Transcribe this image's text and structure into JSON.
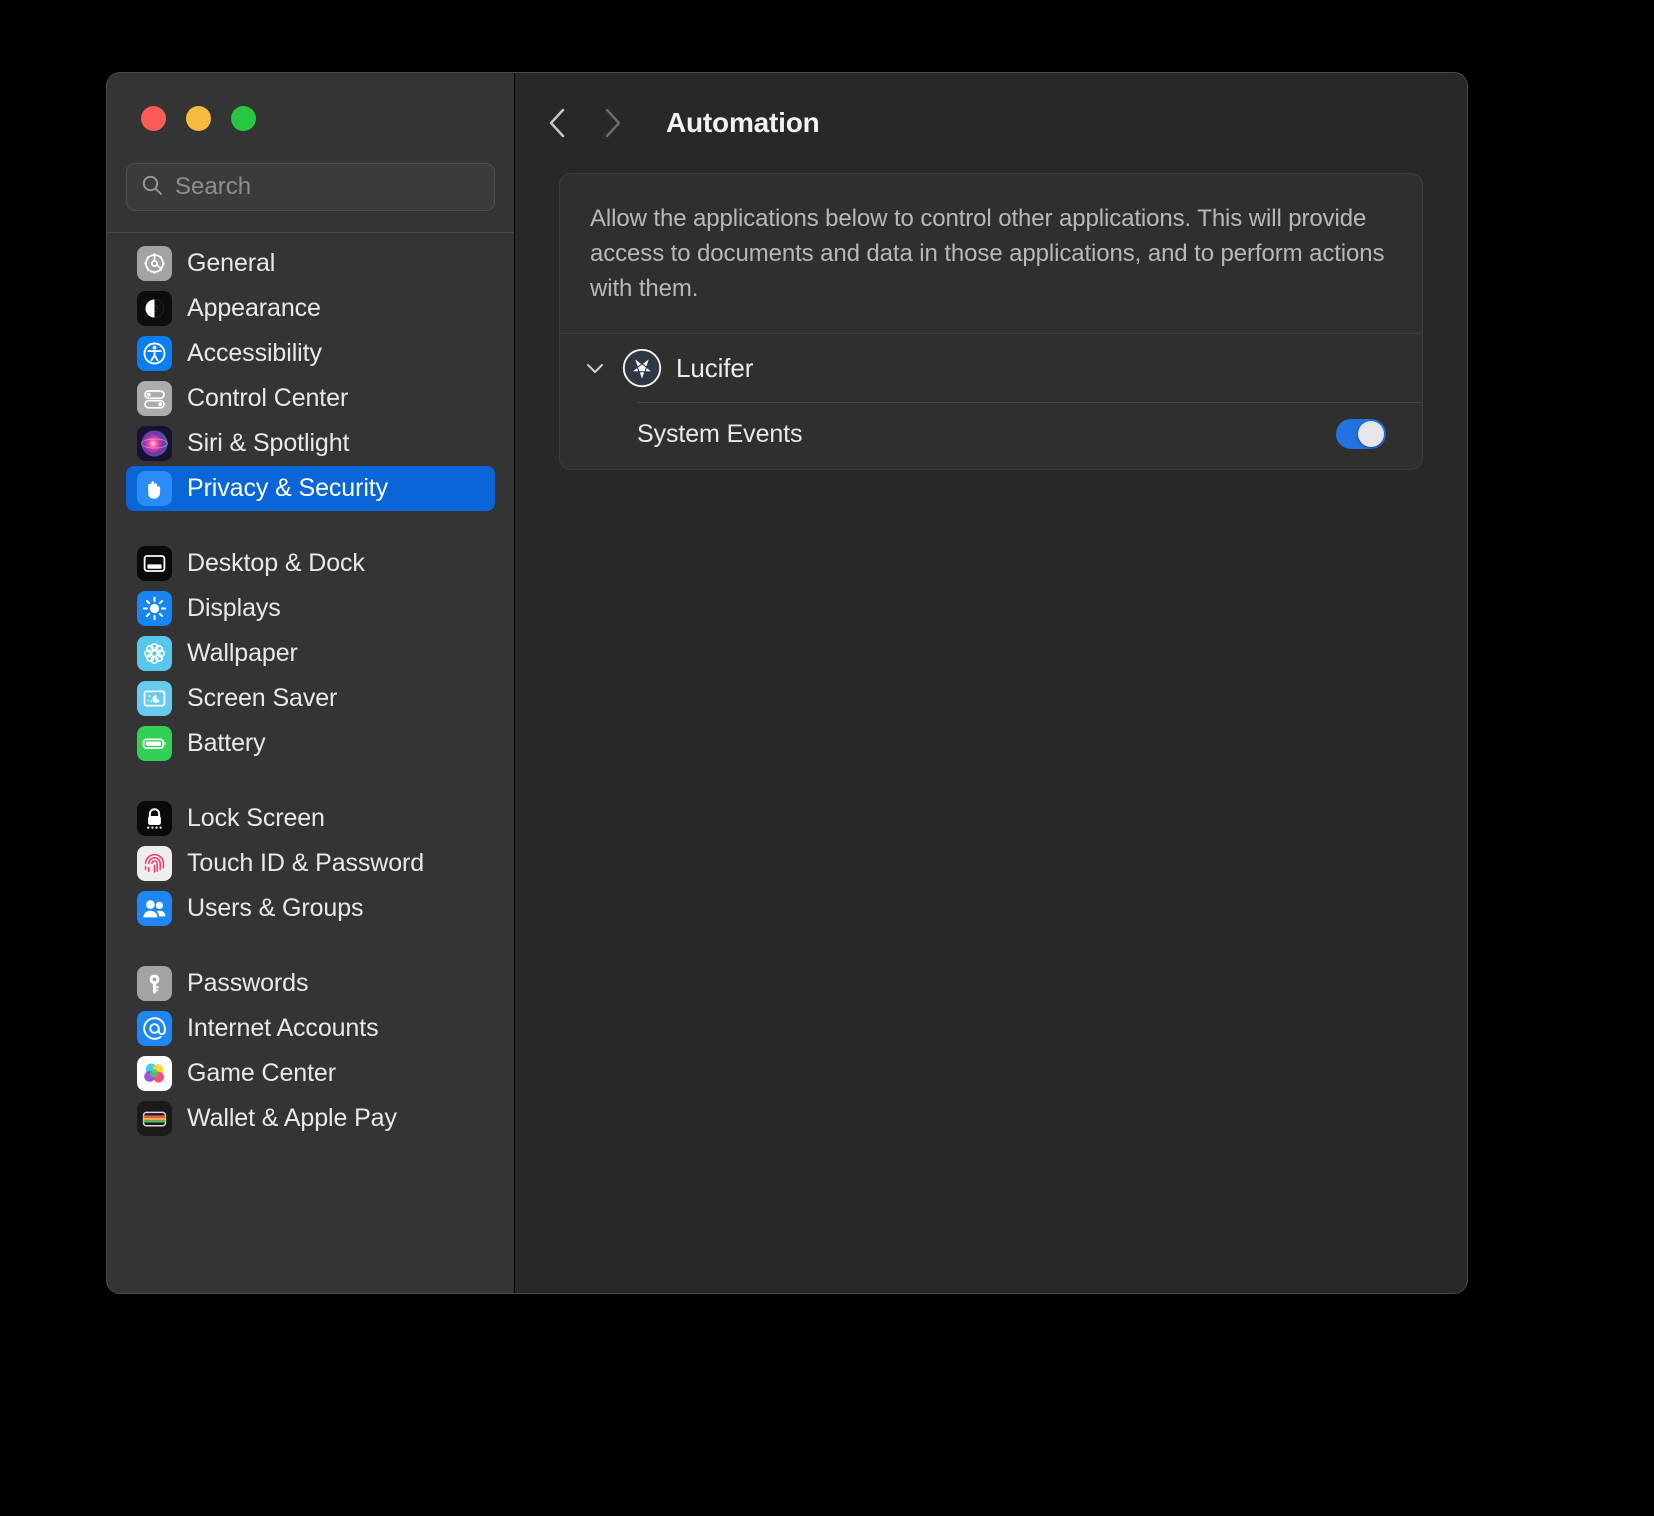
{
  "window": {
    "traffic_lights": [
      {
        "name": "close",
        "color": "#fc5b57"
      },
      {
        "name": "minimize",
        "color": "#f6bb3f"
      },
      {
        "name": "zoom",
        "color": "#27c840"
      }
    ]
  },
  "search": {
    "placeholder": "Search",
    "value": "",
    "icon": "search-icon"
  },
  "sidebar": {
    "groups": [
      {
        "items": [
          {
            "label": "General",
            "icon": "gear-icon",
            "selected": false
          },
          {
            "label": "Appearance",
            "icon": "appearance-icon",
            "selected": false
          },
          {
            "label": "Accessibility",
            "icon": "accessibility-icon",
            "selected": false
          },
          {
            "label": "Control Center",
            "icon": "control-center-icon",
            "selected": false
          },
          {
            "label": "Siri & Spotlight",
            "icon": "siri-icon",
            "selected": false
          },
          {
            "label": "Privacy & Security",
            "icon": "hand-icon",
            "selected": true
          }
        ]
      },
      {
        "items": [
          {
            "label": "Desktop & Dock",
            "icon": "desktop-dock-icon",
            "selected": false
          },
          {
            "label": "Displays",
            "icon": "brightness-icon",
            "selected": false
          },
          {
            "label": "Wallpaper",
            "icon": "flower-icon",
            "selected": false
          },
          {
            "label": "Screen Saver",
            "icon": "screen-saver-icon",
            "selected": false
          },
          {
            "label": "Battery",
            "icon": "battery-icon",
            "selected": false
          }
        ]
      },
      {
        "items": [
          {
            "label": "Lock Screen",
            "icon": "lock-icon",
            "selected": false
          },
          {
            "label": "Touch ID & Password",
            "icon": "fingerprint-icon",
            "selected": false
          },
          {
            "label": "Users & Groups",
            "icon": "users-icon",
            "selected": false
          }
        ]
      },
      {
        "items": [
          {
            "label": "Passwords",
            "icon": "key-icon",
            "selected": false
          },
          {
            "label": "Internet Accounts",
            "icon": "at-sign-icon",
            "selected": false
          },
          {
            "label": "Game Center",
            "icon": "game-center-icon",
            "selected": false
          },
          {
            "label": "Wallet & Apple Pay",
            "icon": "wallet-icon",
            "selected": false
          }
        ]
      }
    ],
    "selection_color": "#0a66d8"
  },
  "toolbar": {
    "back_label": "‹",
    "forward_label": "›",
    "title": "Automation"
  },
  "main": {
    "description": "Allow the applications below to control other applications. This will provide access to documents and data in those applications, and to perform actions with them.",
    "apps": [
      {
        "name": "Lucifer",
        "icon": "pentagram-icon",
        "expanded": true,
        "targets": [
          {
            "name": "System Events",
            "enabled": true
          }
        ]
      }
    ],
    "toggle_on_color": "#2272e0"
  }
}
